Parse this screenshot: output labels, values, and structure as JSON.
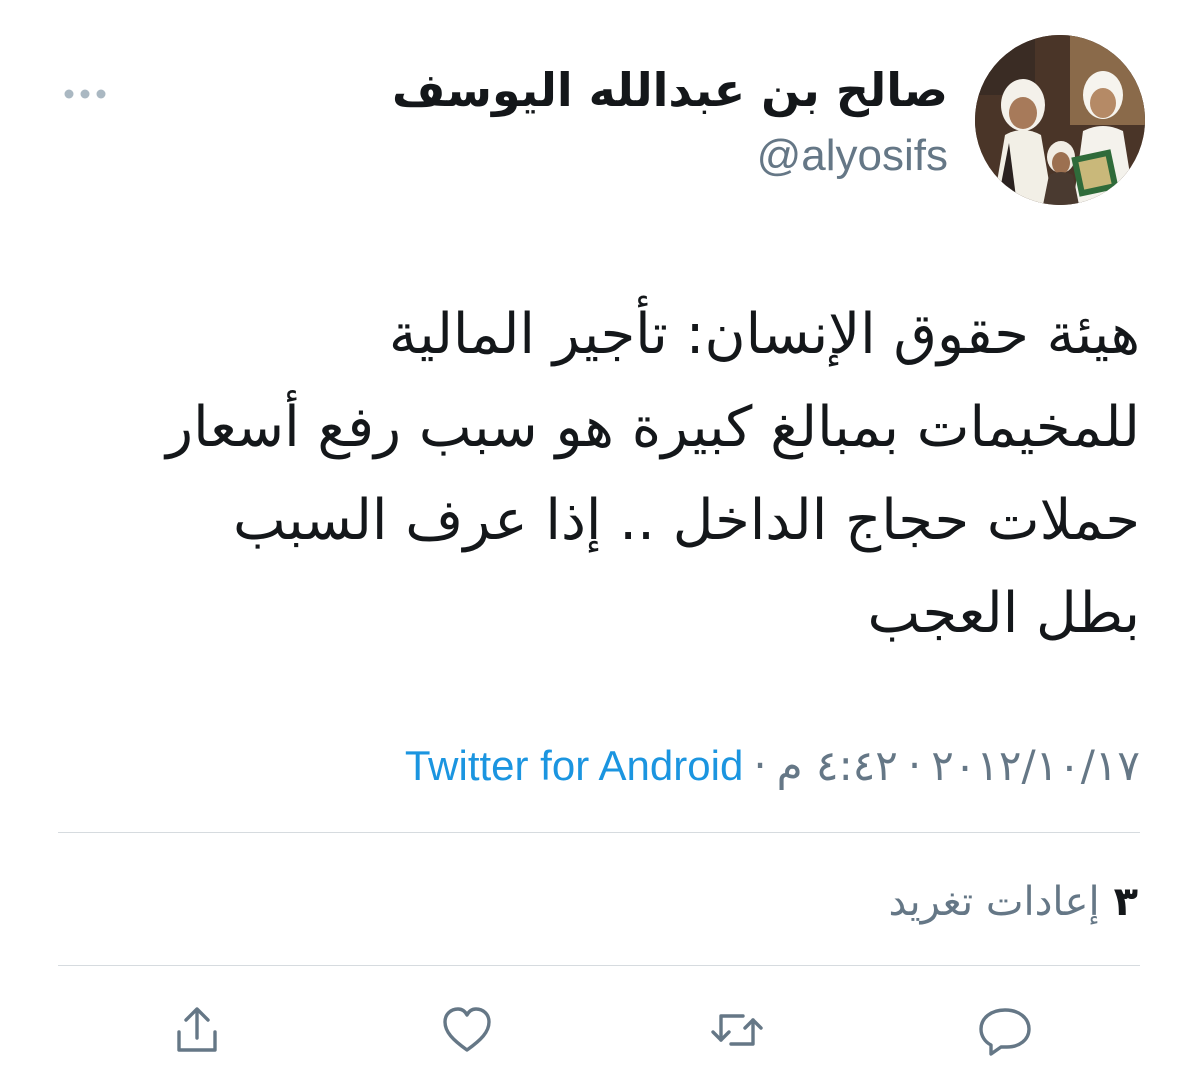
{
  "user": {
    "display_name": "صالح بن عبدالله اليوسف",
    "handle": "@alyosifs",
    "avatar_icon": "profile-photo"
  },
  "tweet": {
    "lines": [
      "هيئة حقوق الإنسان: تأجير المالية",
      "للمخيمات بمبالغ كبيرة هو سبب رفع أسعار",
      "حملات حجاج الداخل .. إذا عرف السبب",
      "بطل العجب"
    ]
  },
  "meta": {
    "date": "٢٠١٢/١٠/١٧",
    "time": "٤:٤٢ م",
    "separator": "·",
    "source": "Twitter for Android"
  },
  "stats": {
    "retweet_count": "٣",
    "retweet_label": "إعادات تغريد"
  },
  "actions": {
    "reply_icon": "reply-icon",
    "retweet_icon": "retweet-icon",
    "like_icon": "heart-icon",
    "share_icon": "share-icon"
  },
  "colors": {
    "link": "#1b95e0",
    "muted": "#657786",
    "text": "#14171a",
    "divider": "#d6dbdf"
  }
}
